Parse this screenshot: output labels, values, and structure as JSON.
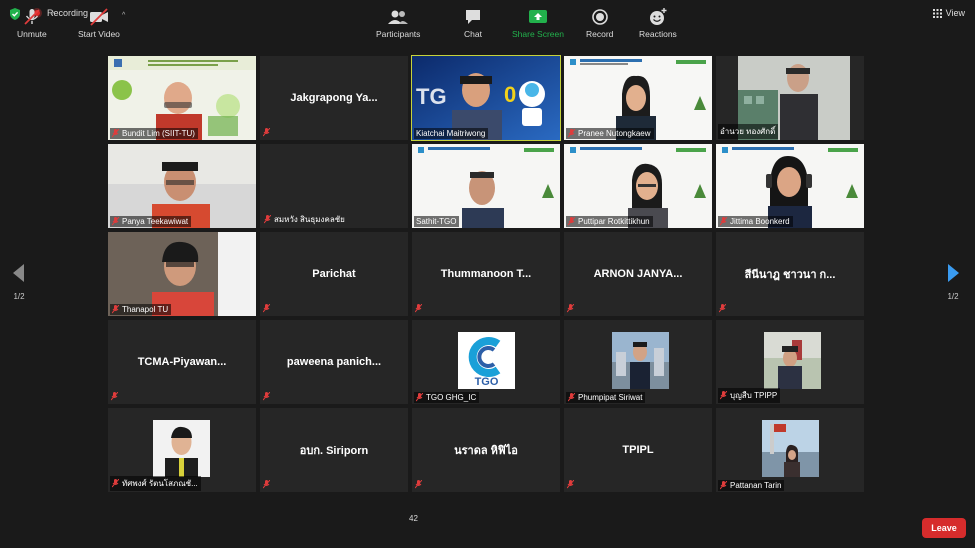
{
  "topbar": {
    "recording_label": "Recording",
    "view_label": "View"
  },
  "tiles": [
    {
      "name": "Bundit Lim (SIIT-TU)",
      "kind": "video",
      "muted": true
    },
    {
      "name": "Jakgrapong Ya...",
      "kind": "name",
      "muted": true
    },
    {
      "name": "Kiatchai Maitriwong",
      "kind": "video",
      "muted": false,
      "active": true
    },
    {
      "name": "Pranee Nutongkaew",
      "kind": "video",
      "muted": true
    },
    {
      "name": "อำนวย ทองศักดิ์",
      "kind": "video",
      "muted": false
    },
    {
      "name": "Panya Teekawiwat",
      "kind": "video",
      "muted": true
    },
    {
      "name": "สมหวัง สินธุมงคลชัย",
      "kind": "name",
      "muted": true
    },
    {
      "name": "Sathit-TGO",
      "kind": "video",
      "muted": false
    },
    {
      "name": "Puttipar Rotkittikhun",
      "kind": "video",
      "muted": true
    },
    {
      "name": "Jittima Boonkerd",
      "kind": "video",
      "muted": true
    },
    {
      "name": "Thanapol TU",
      "kind": "video",
      "muted": true
    },
    {
      "name": "Parichat",
      "kind": "name",
      "muted": true
    },
    {
      "name": "Thummanoon T...",
      "kind": "name",
      "muted": true
    },
    {
      "name": "ARNON JANYA...",
      "kind": "name",
      "muted": true
    },
    {
      "name": "สีนีนาฎ ชาวนา ก...",
      "kind": "name",
      "muted": true
    },
    {
      "name": "TCMA-Piyawan...",
      "kind": "name",
      "muted": true
    },
    {
      "name": "paweena panich...",
      "kind": "name",
      "muted": true
    },
    {
      "name": "TGO GHG_IC",
      "kind": "logo",
      "muted": true,
      "logo_text": "TGO"
    },
    {
      "name": "Phumpipat Siriwat",
      "kind": "photo",
      "muted": true
    },
    {
      "name": "บุญสืบ TPIPP",
      "kind": "photo",
      "muted": true
    },
    {
      "name": "ทัศพงศ์ รัตนโสภณชั...",
      "kind": "photo",
      "muted": true
    },
    {
      "name": "อบก. Siriporn",
      "kind": "name",
      "muted": true
    },
    {
      "name": "นราดล หิฟิไอ",
      "kind": "name",
      "muted": true
    },
    {
      "name": "TPIPL",
      "kind": "name",
      "muted": true
    },
    {
      "name": "Pattanan Tarin",
      "kind": "photo",
      "muted": true
    }
  ],
  "video_overlays": {
    "bundit_logo": "CDM",
    "kiatchai_text": "TG",
    "office_header": "Project Evaluation and Approval Office"
  },
  "pagination": {
    "left": "1/2",
    "right": "1/2"
  },
  "toolbar": {
    "unmute": "Unmute",
    "start_video": "Start Video",
    "participants": "Participants",
    "participants_count": "42",
    "chat": "Chat",
    "share_screen": "Share Screen",
    "record": "Record",
    "reactions": "Reactions",
    "leave": "Leave"
  },
  "colors": {
    "accent_green": "#22b14c",
    "leave_red": "#d62c2c",
    "active_border": "#c6d33b"
  }
}
